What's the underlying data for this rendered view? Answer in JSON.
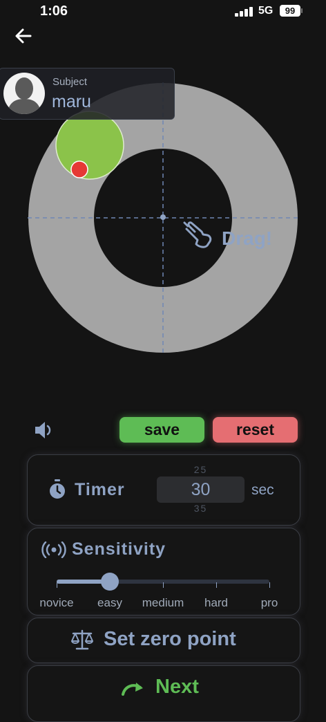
{
  "status_bar": {
    "time": "1:06",
    "network": "5G",
    "battery": "99"
  },
  "subject": {
    "label": "Subject",
    "name": "maru"
  },
  "target": {
    "hint": "Drag!"
  },
  "controls": {
    "save_label": "save",
    "reset_label": "reset"
  },
  "timer": {
    "label": "Timer",
    "value": "30",
    "prev_value": "25",
    "next_value": "35",
    "unit": "sec"
  },
  "sensitivity": {
    "label": "Sensitivity",
    "levels": [
      "novice",
      "easy",
      "medium",
      "hard",
      "pro"
    ],
    "selected_index": 1
  },
  "zero_point": {
    "label": "Set zero point"
  },
  "next": {
    "label": "Next"
  },
  "colors": {
    "accent_blue": "#8fa3c4",
    "save_green": "#5ebc55",
    "reset_red": "#e56e72",
    "ring_gray": "#a4a4a4",
    "ball_green": "#8bc34a",
    "dot_red": "#e53935"
  },
  "icons": {
    "back": "arrow-left-icon",
    "sound": "speaker-icon",
    "timer": "stopwatch-icon",
    "sensitivity": "broadcast-icon",
    "zero_point": "balance-scale-icon",
    "next": "redo-arrow-icon",
    "drag": "pointing-hand-icon"
  }
}
